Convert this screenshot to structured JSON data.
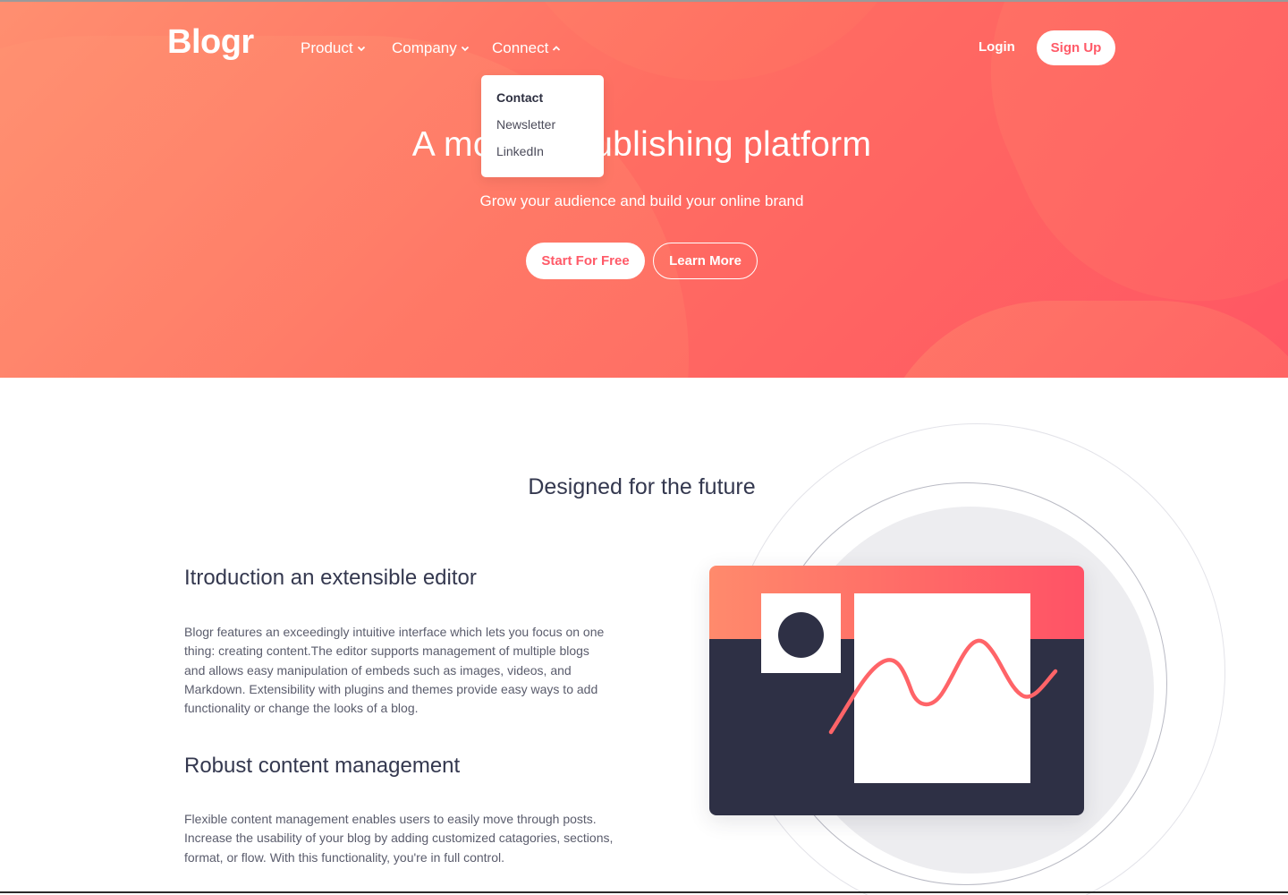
{
  "header": {
    "logo": "Blogr",
    "nav": [
      {
        "label": "Product"
      },
      {
        "label": "Company"
      },
      {
        "label": "Connect"
      }
    ],
    "login_label": "Login",
    "signup_label": "Sign Up"
  },
  "dropdown": {
    "items": [
      "Contact",
      "Newsletter",
      "LinkedIn"
    ]
  },
  "hero": {
    "title": "A modern publishing platform",
    "subtitle": "Grow your audience and build your online brand",
    "start_label": "Start For Free",
    "learn_label": "Learn More"
  },
  "section": {
    "title": "Designed for the future",
    "features": [
      {
        "title": "Itroduction an extensible editor",
        "text": "Blogr features an exceedingly intuitive interface which lets you focus on one thing: creating content.The editor supports management of multiple blogs and allows easy manipulation of embeds such as images, videos, and Markdown. Extensibility with plugins and themes provide easy ways to add functionality or change the looks of a blog."
      },
      {
        "title": "Robust content management",
        "text": "Flexible content management enables users to easily move through posts. Increase the usability of your blog by adding customized catagories, sections, format, or flow. With this functionality, you're in full control."
      }
    ]
  },
  "colors": {
    "brand_red": "#ff5a68",
    "dark_navy": "#2e3045",
    "heading": "#34384f"
  },
  "icons": {
    "chevron_down": "chevron-down-icon",
    "chevron_up": "chevron-up-icon"
  }
}
